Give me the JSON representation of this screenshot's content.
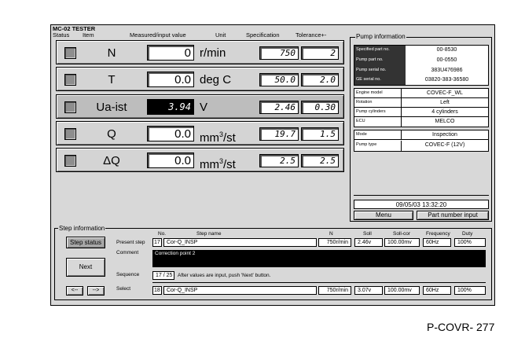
{
  "window": {
    "title": "MC-02 TESTER"
  },
  "headers": {
    "status": "Status",
    "item": "Item",
    "measured": "Measured/input value",
    "unit": "Unit",
    "spec": "Specification",
    "tolerance": "Tolerance+-"
  },
  "rows": [
    {
      "item": "N",
      "value": "0",
      "unit": "r/min",
      "sup": "",
      "spec": "750",
      "tol": "2"
    },
    {
      "item": "T",
      "value": "0.0",
      "unit": "deg C",
      "sup": "",
      "spec": "50.0",
      "tol": "2.0"
    },
    {
      "item": "Ua-ist",
      "value": "3.94",
      "unit": "V",
      "sup": "",
      "spec": "2.46",
      "tol": "0.30"
    },
    {
      "item": "Q",
      "value": "0.0",
      "unit": "mm",
      "sup": "3",
      "unit2": "/st",
      "spec": "19.7",
      "tol": "1.5"
    },
    {
      "item": "ΔQ",
      "value": "0.0",
      "unit": "mm",
      "sup": "3",
      "unit2": "/st",
      "spec": "2.5",
      "tol": "2.5"
    }
  ],
  "pump": {
    "title": "Pump information",
    "group1": [
      {
        "label": "Specified part no.",
        "value": "00-8530"
      },
      {
        "label": "Pump part no.",
        "value": "00-0550"
      },
      {
        "label": "Pump serial no.",
        "value": "383U476986"
      },
      {
        "label": "GE serial no.",
        "value": "03820-383-36580"
      }
    ],
    "group2": [
      {
        "label": "Engine model",
        "value": "COVEC-F_WL"
      },
      {
        "label": "Rotation",
        "value": "Left"
      },
      {
        "label": "Pump cylinders",
        "value": "4 cylinders"
      },
      {
        "label": "ECU",
        "value": "MELCO"
      }
    ],
    "group3": [
      {
        "label": "Mode",
        "value": "Inspection"
      },
      {
        "label": "Pump type",
        "value": "COVEC-F (12V)"
      }
    ],
    "datetime": "09/05/03  13:32:20",
    "menu_label": "Menu",
    "part_input_label": "Part number input"
  },
  "step": {
    "title": "Step information",
    "headers": {
      "no": "No.",
      "name": "Step name",
      "n": "N",
      "soll": "Soll",
      "sollcor": "Soll-cor",
      "freq": "Frequency",
      "duty": "Duty"
    },
    "status_btn": "Step status",
    "next_btn": "Next",
    "prev_btn": "<--",
    "fwd_btn": "-->",
    "labels": {
      "present": "Present step",
      "comment": "Comment",
      "sequence": "Sequence",
      "select": "Select"
    },
    "present": {
      "no": "17",
      "name": "Cor-Q_INSP",
      "n": "750r/min",
      "soll": "2.46v",
      "sollcor": "100.00mv",
      "freq": "60Hz",
      "duty": "100%"
    },
    "comment": "Correction point 2",
    "sequence": "17 / 25",
    "sequence_hint": "After values are input, push 'Next' button.",
    "select": {
      "no": "18",
      "name": "Cor-Q_INSP",
      "n": "750r/min",
      "soll": "3.07v",
      "sollcor": "100.00mv",
      "freq": "60Hz",
      "duty": "100%"
    }
  },
  "footer": {
    "code": "P-COVR- 277"
  }
}
